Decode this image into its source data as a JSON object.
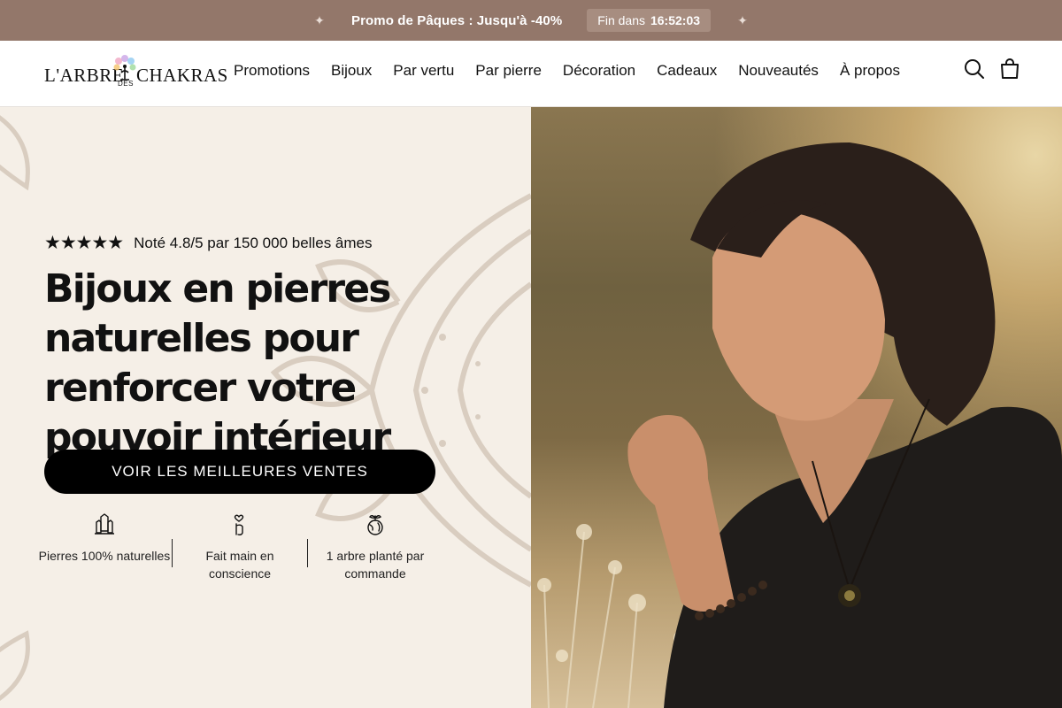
{
  "promo": {
    "text": "Promo de Pâques : Jusqu'à -40%",
    "countdown_label": "Fin dans",
    "countdown_time": "16:52:03"
  },
  "brand": {
    "name_left": "L'ARBRE",
    "name_small": "DES",
    "name_right": "CHAKRAS"
  },
  "nav": {
    "items": [
      "Promotions",
      "Bijoux",
      "Par vertu",
      "Par pierre",
      "Décoration",
      "Cadeaux",
      "Nouveautés",
      "À propos"
    ]
  },
  "header_icons": [
    "search-icon",
    "shopping-bag-icon"
  ],
  "hero": {
    "rating_stars": "★★★★★",
    "rating_value": 5,
    "rating_text": "Noté 4.8/5 par 150 000 belles âmes",
    "headline": "Bijoux en pierres naturelles pour renforcer votre pouvoir intérieur",
    "cta_label": "VOIR LES MEILLEURES VENTES",
    "features": [
      {
        "icon": "crystal-icon",
        "label": "Pierres 100% naturelles"
      },
      {
        "icon": "hand-heart-icon",
        "label": "Fait main en conscience"
      },
      {
        "icon": "tree-globe-icon",
        "label": "1 arbre planté par commande"
      }
    ]
  },
  "colors": {
    "promo_bar": "#93776a",
    "hero_bg": "#f5efe7",
    "cta_bg": "#000000",
    "text": "#111111"
  }
}
